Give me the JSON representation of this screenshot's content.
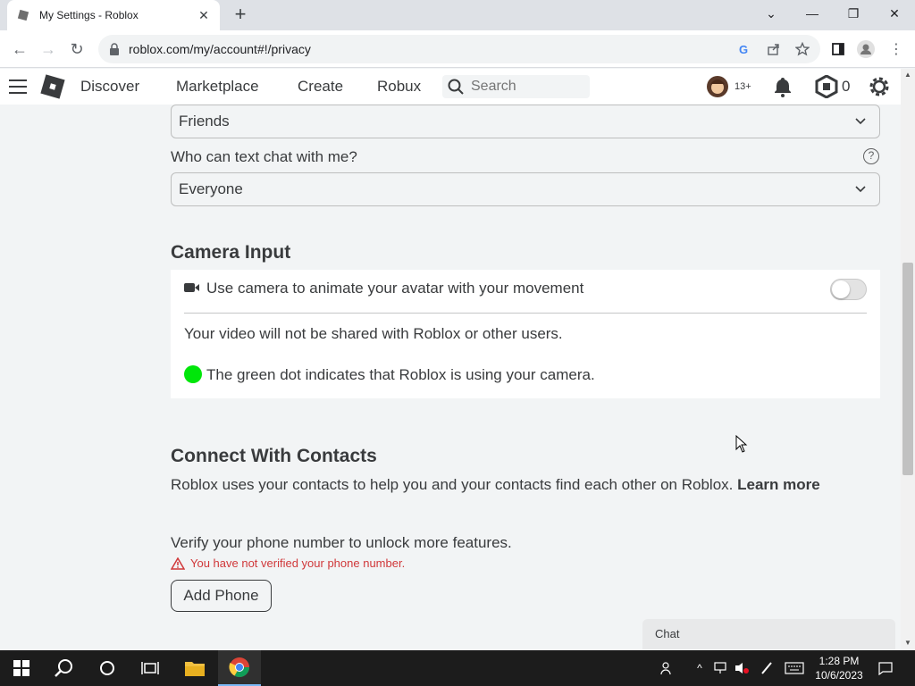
{
  "browser": {
    "tab_title": "My Settings - Roblox",
    "url": "roblox.com/my/account#!/privacy"
  },
  "header": {
    "nav": [
      "Discover",
      "Marketplace",
      "Create",
      "Robux"
    ],
    "search_placeholder": "Search",
    "age_badge": "13+",
    "robux_count": "0"
  },
  "privacy": {
    "chat_setting_value": "Friends",
    "text_chat_label": "Who can text chat with me?",
    "text_chat_value": "Everyone"
  },
  "camera": {
    "title": "Camera Input",
    "toggle_label": "Use camera to animate your avatar with your movement",
    "toggle_on": false,
    "note": "Your video will not be shared with Roblox or other users.",
    "dot_note": "The green dot indicates that Roblox is using your camera."
  },
  "contacts": {
    "title": "Connect With Contacts",
    "description": "Roblox uses your contacts to help you and your contacts find each other on Roblox.",
    "learn_more": "Learn more",
    "verify_text": "Verify your phone number to unlock more features.",
    "warning": "You have not verified your phone number.",
    "add_phone_label": "Add Phone"
  },
  "chat": {
    "label": "Chat"
  },
  "taskbar": {
    "time": "1:28 PM",
    "date": "10/6/2023"
  },
  "colors": {
    "accent_green": "#00e60a",
    "warning_red": "#d0383a",
    "page_bg": "#f2f4f5"
  }
}
